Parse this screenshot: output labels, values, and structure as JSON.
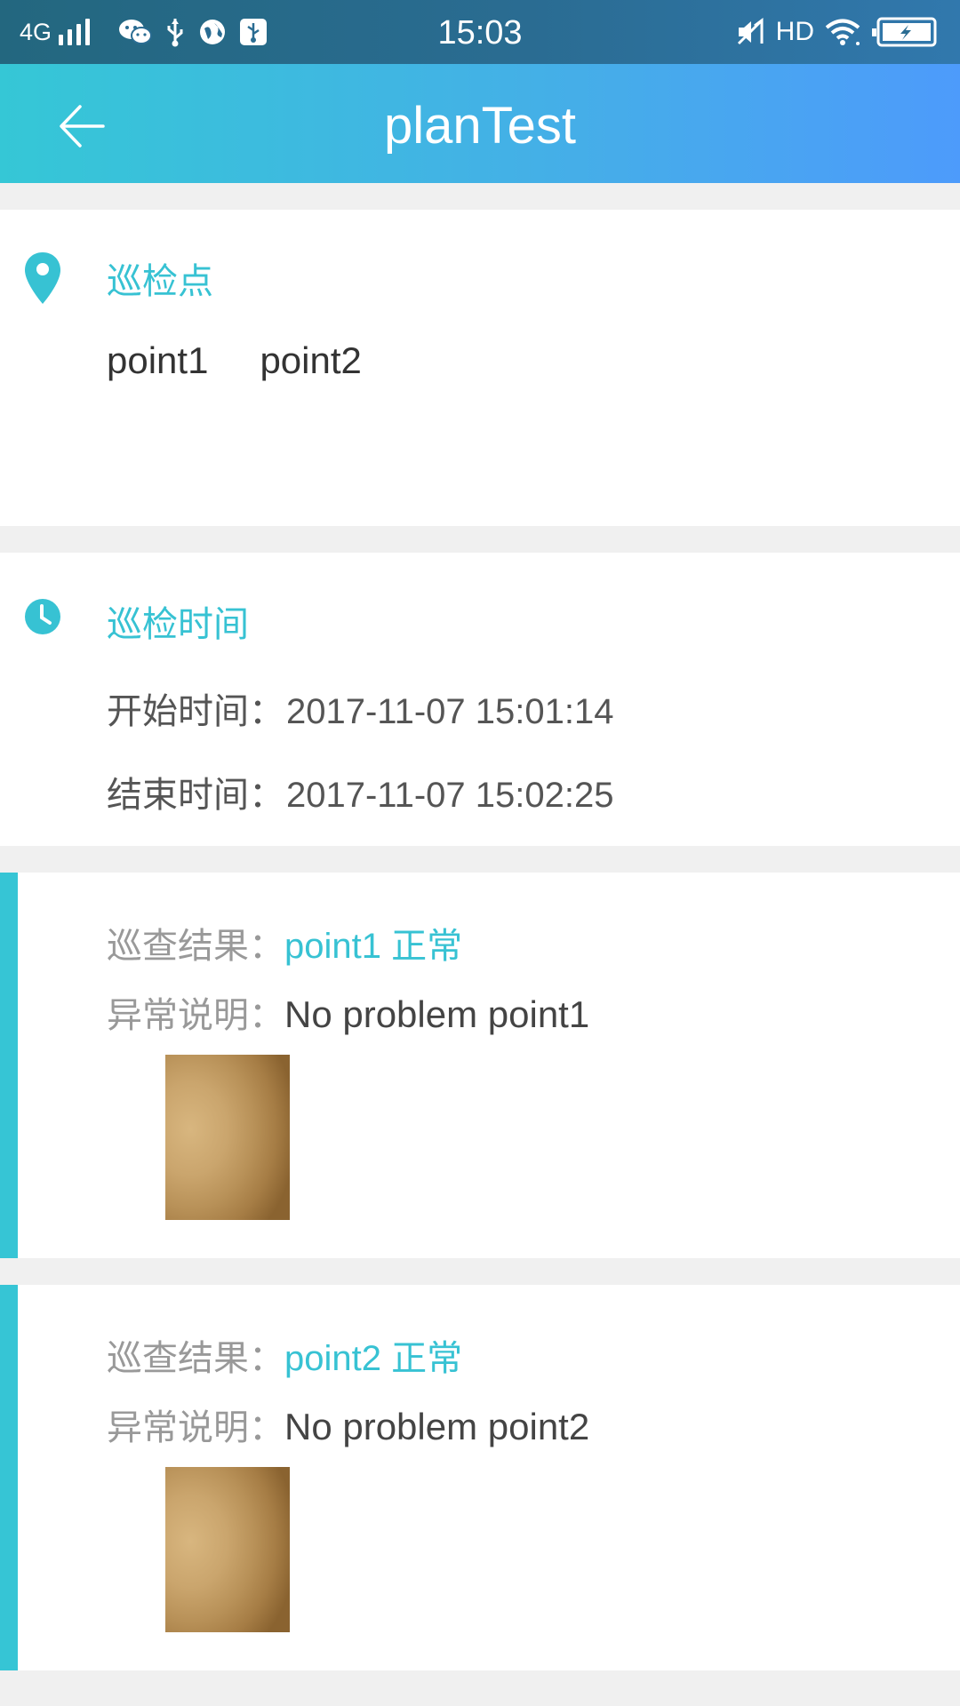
{
  "status_bar": {
    "network": "4G",
    "time": "15:03",
    "hd": "HD"
  },
  "header": {
    "title": "planTest"
  },
  "points_section": {
    "title": "巡检点",
    "points": [
      "point1",
      "point2"
    ]
  },
  "time_section": {
    "title": "巡检时间",
    "start_label": "开始时间：",
    "start_value": "2017-11-07 15:01:14",
    "end_label": "结束时间：",
    "end_value": "2017-11-07 15:02:25"
  },
  "results": [
    {
      "result_label": "巡查结果：",
      "result_point": "point1",
      "result_status": "正常",
      "note_label": "异常说明：",
      "note_value": "No problem point1"
    },
    {
      "result_label": "巡查结果：",
      "result_point": "point2",
      "result_status": "正常",
      "note_label": "异常说明：",
      "note_value": "No problem point2"
    }
  ],
  "colors": {
    "accent": "#37c2d3",
    "header_start": "#35c7d6",
    "header_end": "#4d9bfb"
  }
}
